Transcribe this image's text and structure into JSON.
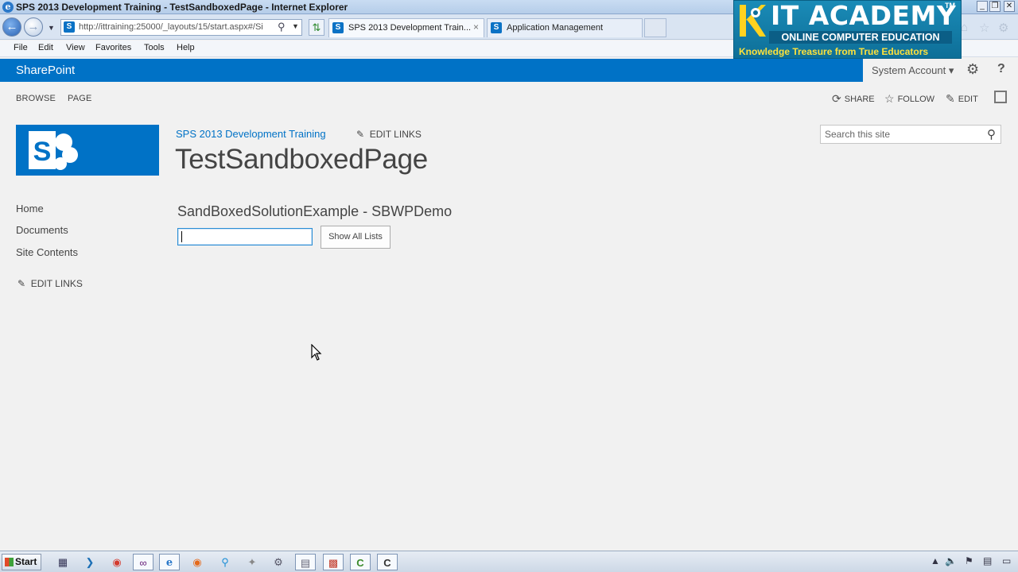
{
  "window": {
    "title": "SPS 2013 Development Training - TestSandboxedPage - Internet Explorer",
    "controls": [
      "_",
      "❐",
      "✕"
    ]
  },
  "browser": {
    "address": "http://ittraining:25000/_layouts/15/start.aspx#/Si",
    "tabs": [
      {
        "label": "SPS 2013 Development Train...",
        "close": "×"
      },
      {
        "label": "Application Management"
      }
    ],
    "menu": [
      "File",
      "Edit",
      "View",
      "Favorites",
      "Tools",
      "Help"
    ]
  },
  "banner": {
    "title": "IT ACADEMY",
    "trademark": "TM",
    "subtitle": "ONLINE COMPUTER EDUCATION",
    "tagline": "Knowledge Treasure from True Educators"
  },
  "suitebar": {
    "brand": "SharePoint",
    "account": "System Account ▾",
    "help": "?"
  },
  "ribbon": {
    "tabs": [
      "BROWSE",
      "PAGE"
    ],
    "actions": {
      "share": "SHARE",
      "follow": "FOLLOW",
      "edit": "EDIT"
    }
  },
  "site": {
    "logo_letter": "S",
    "site_name": "SPS 2013 Development Training",
    "edit_links": "EDIT LINKS",
    "page_title": "TestSandboxedPage",
    "search_placeholder": "Search this site"
  },
  "quicklaunch": {
    "items": [
      "Home",
      "Documents",
      "Site Contents"
    ],
    "edit_links": "EDIT LINKS"
  },
  "webpart": {
    "title": "SandBoxedSolutionExample - SBWPDemo",
    "input_value": "",
    "button": "Show All Lists"
  },
  "taskbar": {
    "start": "Start"
  },
  "colors": {
    "suite_blue": "#0072c6",
    "page_bg": "#f1f1f1",
    "banner_teal": "#0e6f98",
    "tagline_yellow": "#ffe23b"
  }
}
